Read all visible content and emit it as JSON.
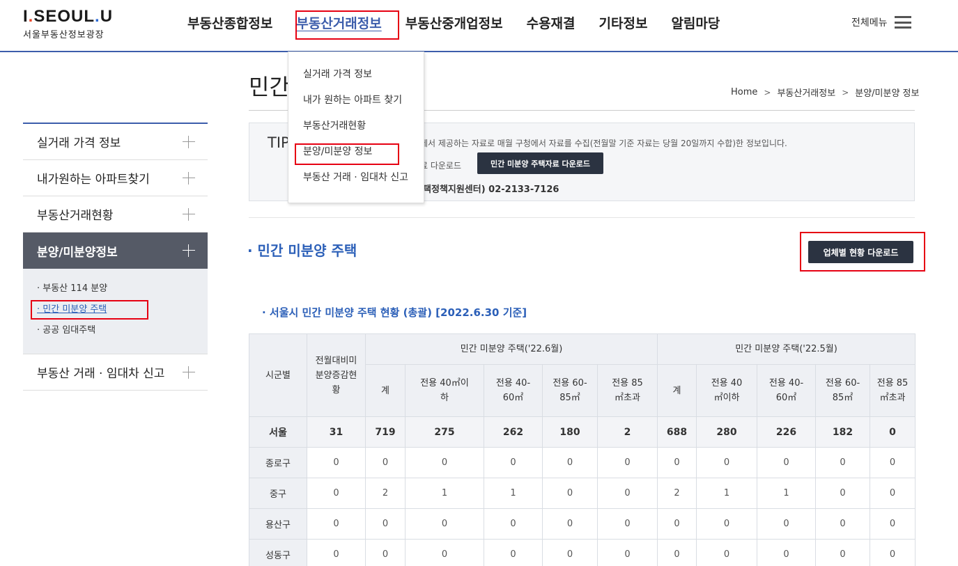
{
  "header": {
    "logo_main_a": "I",
    "logo_main_dot1": ".",
    "logo_main_b": "SE",
    "logo_main_c": "UL",
    "logo_main_dot2": ".",
    "logo_main_d": "U",
    "logo_sub": "서울부동산정보광장",
    "nav": [
      "부동산종합정보",
      "부동산거래정보",
      "부동산중개업정보",
      "수용재결",
      "기타정보",
      "알림마당"
    ],
    "all_menu_label": "전체메뉴"
  },
  "dropdown": {
    "items": [
      "실거래 가격 정보",
      "내가 원하는 아파트 찾기",
      "부동산거래현황",
      "분양/미분양 정보",
      "부동산 거래 · 임대차 신고"
    ]
  },
  "page": {
    "title": "민간",
    "breadcrumb": [
      "Home",
      "부동산거래정보",
      "분양/미분양 정보"
    ]
  },
  "tip": {
    "label": "TIP",
    "text1": "에서 제공하는 자료로 매월 구청에서 자료를 수집(전월말 기준 자료는 당월 20일까지 수합)한 정보입니다.",
    "text2": "료 다운로드",
    "button": "민간 미분양 주택자료 다운로드",
    "text3": "택정책지원센터) 02-2133-7126"
  },
  "sidebar": {
    "items": [
      {
        "label": "실거래 가격 정보"
      },
      {
        "label": "내가원하는 아파트찾기"
      },
      {
        "label": "부동산거래현황"
      },
      {
        "label": "분양/미분양정보"
      },
      {
        "label": "부동산 거래 · 임대차 신고"
      }
    ],
    "sub_items": [
      "· 부동산 114 분양",
      "· 민간 미분양 주택",
      "· 공공 임대주택"
    ]
  },
  "section": {
    "title": "· 민간 미분양 주택",
    "download_button": "업체별 현황 다운로드",
    "sub_title": "· 서울시 민간 미분양 주택 현황 (총괄) [2022.6.30 기준]"
  },
  "table": {
    "h_region": "시군별",
    "h_change": "전월대비미분양증감현황",
    "h_group1": "민간 미분양 주택('22.6월)",
    "h_group2": "민간 미분양 주택('22.5월)",
    "sub_headers": [
      "계",
      "전용 40㎡이하",
      "전용 40-60㎡",
      "전용 60-85㎡",
      "전용 85㎡초과"
    ],
    "rows": [
      {
        "region": "서울",
        "values": [
          "31",
          "719",
          "275",
          "262",
          "180",
          "2",
          "688",
          "280",
          "226",
          "182",
          "0"
        ]
      },
      {
        "region": "종로구",
        "values": [
          "0",
          "0",
          "0",
          "0",
          "0",
          "0",
          "0",
          "0",
          "0",
          "0",
          "0"
        ]
      },
      {
        "region": "중구",
        "values": [
          "0",
          "2",
          "1",
          "1",
          "0",
          "0",
          "2",
          "1",
          "1",
          "0",
          "0"
        ]
      },
      {
        "region": "용산구",
        "values": [
          "0",
          "0",
          "0",
          "0",
          "0",
          "0",
          "0",
          "0",
          "0",
          "0",
          "0"
        ]
      },
      {
        "region": "성동구",
        "values": [
          "0",
          "0",
          "0",
          "0",
          "0",
          "0",
          "0",
          "0",
          "0",
          "0",
          "0"
        ]
      }
    ]
  },
  "colors": {
    "accent": "#3c5dab",
    "link": "#2b5fb8",
    "highlight": "#e60012",
    "button_dark": "#2b3341"
  }
}
